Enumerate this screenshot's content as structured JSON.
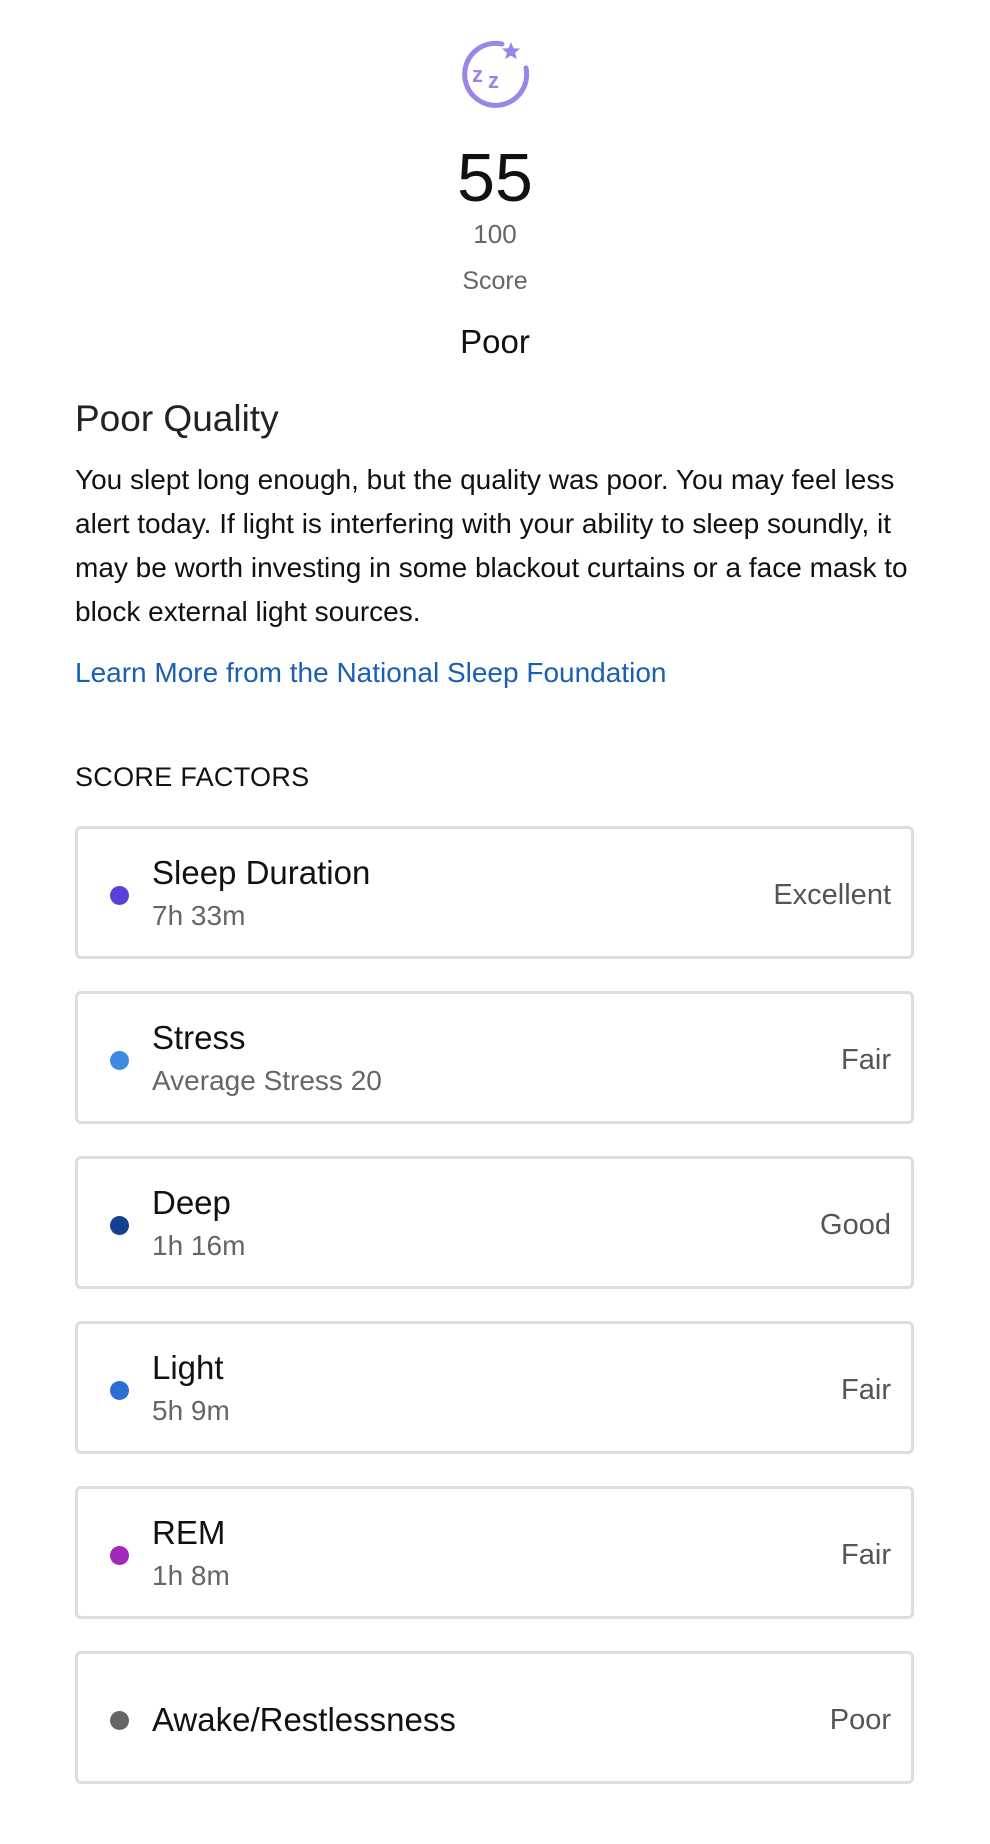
{
  "score": {
    "icon": "sleep-zz-star-icon",
    "icon_color": "#9B86E8",
    "value": "55",
    "max": "100",
    "label": "Score",
    "rating": "Poor"
  },
  "quality": {
    "title": "Poor Quality",
    "description": "You slept long enough, but the quality was poor. You may feel less alert today. If light is interfering with your ability to sleep soundly, it may be worth investing in some blackout curtains or a face mask to block external light sources.",
    "link_label": "Learn More from the National Sleep Foundation",
    "link_color": "#1A5FB4"
  },
  "score_factors": {
    "heading": "SCORE FACTORS",
    "items": [
      {
        "name": "Sleep Duration",
        "detail": "7h 33m",
        "rating": "Excellent",
        "dot_color": "#5B3FD6"
      },
      {
        "name": "Stress",
        "detail": "Average Stress 20",
        "rating": "Fair",
        "dot_color": "#3D8BE0"
      },
      {
        "name": "Deep",
        "detail": "1h 16m",
        "rating": "Good",
        "dot_color": "#15408F"
      },
      {
        "name": "Light",
        "detail": "5h 9m",
        "rating": "Fair",
        "dot_color": "#2A6FD4"
      },
      {
        "name": "REM",
        "detail": "1h 8m",
        "rating": "Fair",
        "dot_color": "#A128B8"
      },
      {
        "name": "Awake/Restlessness",
        "detail": "",
        "rating": "Poor",
        "dot_color": "#666666"
      }
    ]
  }
}
